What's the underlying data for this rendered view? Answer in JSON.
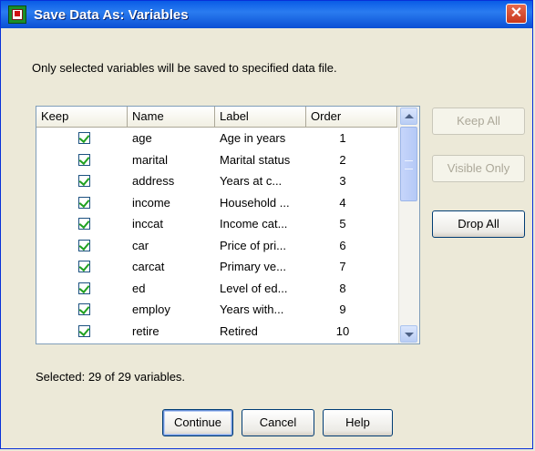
{
  "window": {
    "title": "Save Data As: Variables",
    "close_glyph": "✕"
  },
  "instruction": "Only selected variables will be saved to specified data file.",
  "table": {
    "columns": [
      "Keep",
      "Name",
      "Label",
      "Order"
    ],
    "rows": [
      {
        "keep": true,
        "name": "age",
        "label": "Age in years",
        "order": "1"
      },
      {
        "keep": true,
        "name": "marital",
        "label": "Marital status",
        "order": "2"
      },
      {
        "keep": true,
        "name": "address",
        "label": "Years at c...",
        "order": "3"
      },
      {
        "keep": true,
        "name": "income",
        "label": "Household ...",
        "order": "4"
      },
      {
        "keep": true,
        "name": "inccat",
        "label": "Income cat...",
        "order": "5"
      },
      {
        "keep": true,
        "name": "car",
        "label": "Price of pri...",
        "order": "6"
      },
      {
        "keep": true,
        "name": "carcat",
        "label": "Primary ve...",
        "order": "7"
      },
      {
        "keep": true,
        "name": "ed",
        "label": "Level of ed...",
        "order": "8"
      },
      {
        "keep": true,
        "name": "employ",
        "label": "Years with...",
        "order": "9"
      },
      {
        "keep": true,
        "name": "retire",
        "label": "Retired",
        "order": "10"
      }
    ]
  },
  "side_buttons": {
    "keep_all": "Keep All",
    "visible_only": "Visible Only",
    "drop_all": "Drop All"
  },
  "selected_status": "Selected: 29 of 29 variables.",
  "footer_buttons": {
    "continue": "Continue",
    "cancel": "Cancel",
    "help": "Help"
  }
}
